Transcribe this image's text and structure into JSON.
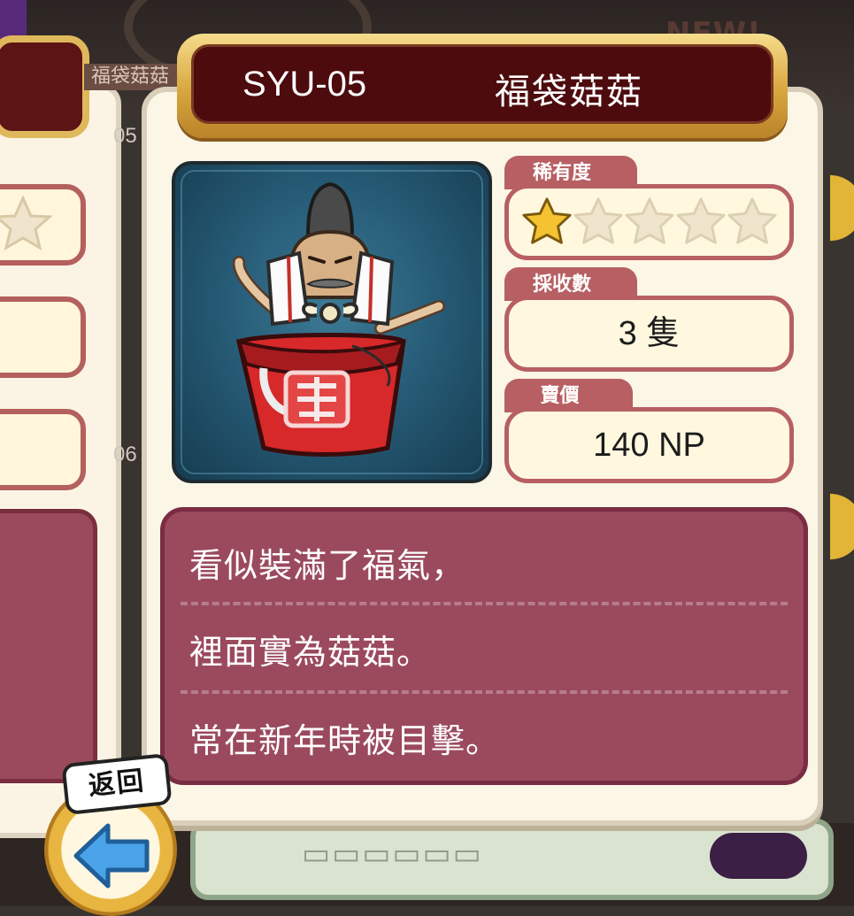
{
  "card": {
    "code": "SYU-05",
    "name": "福袋菇菇"
  },
  "rarity": {
    "label": "稀有度",
    "filled": 1,
    "total": 5
  },
  "harvest": {
    "label": "採收數",
    "value": "3 隻"
  },
  "price": {
    "label": "賣價",
    "value": "140 NP"
  },
  "description": {
    "lines": [
      "看似裝滿了福氣，",
      "裡面實為菇菇。",
      "常在新年時被目擊。"
    ]
  },
  "back_button": {
    "label": "返回"
  },
  "background": {
    "new_badge": "NEW!",
    "left_card_title": "福袋菇菇",
    "left_card_code_1": "05",
    "left_card_code_2": "06"
  },
  "colors": {
    "title_bg": "#4d0b0e",
    "title_frame": "#d8a63f",
    "panel_border": "#b75f62",
    "description_bg": "#9b4a5e",
    "star_filled": "#f5c331",
    "star_empty": "#efe5cd",
    "portrait_bg": "#275d78"
  }
}
